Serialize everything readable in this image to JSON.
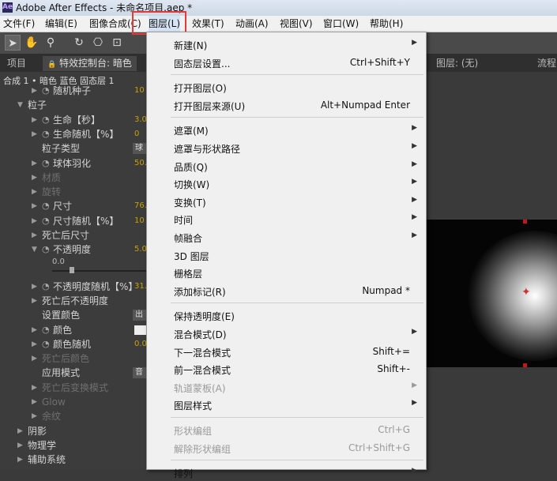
{
  "window": {
    "title": "Adobe After Effects - 未命名项目.aep *"
  },
  "menubar": {
    "items": [
      "文件(F)",
      "编辑(E)",
      "图像合成(C)",
      "图层(L)",
      "效果(T)",
      "动画(A)",
      "视图(V)",
      "窗口(W)",
      "帮助(H)"
    ],
    "active": "图层(L)"
  },
  "panels": {
    "project_tab": "项目",
    "effect_controls_tab": "特效控制台: 暗色",
    "layer_tab": "图层: (无)",
    "flow_tab": "流程",
    "breadcrumb": "合成 1 • 暗色 蓝色 固态层 1"
  },
  "effect_props": [
    {
      "label": "随机种子",
      "value": "10",
      "indent": 2,
      "stopwatch": true
    },
    {
      "label": "粒子",
      "value": "",
      "indent": 1,
      "open": true
    },
    {
      "label": "生命【秒】",
      "value": "3.0",
      "indent": 2,
      "stopwatch": true
    },
    {
      "label": "生命随机【%】",
      "value": "0",
      "indent": 2,
      "stopwatch": true
    },
    {
      "label": "粒子类型",
      "value": "球",
      "indent": 2,
      "dropdown": true
    },
    {
      "label": "球体羽化",
      "value": "50.",
      "indent": 2,
      "stopwatch": true
    },
    {
      "label": "材质",
      "value": "",
      "indent": 2,
      "disabled": true
    },
    {
      "label": "旋转",
      "value": "",
      "indent": 2,
      "disabled": true
    },
    {
      "label": "尺寸",
      "value": "76.",
      "indent": 2,
      "stopwatch": true
    },
    {
      "label": "尺寸随机【%】",
      "value": "10",
      "indent": 2,
      "stopwatch": true
    },
    {
      "label": "死亡后尺寸",
      "value": "",
      "indent": 2
    },
    {
      "label": "不透明度",
      "value": "5.0",
      "indent": 2,
      "stopwatch": true,
      "open": true
    },
    {
      "label": "",
      "value": "0.0",
      "indent": 3,
      "slider": true
    },
    {
      "label": "不透明度随机【%】",
      "value": "31.",
      "indent": 2,
      "stopwatch": true
    },
    {
      "label": "死亡后不透明度",
      "value": "",
      "indent": 2
    },
    {
      "label": "设置颜色",
      "value": "出",
      "indent": 2,
      "dropdown": true
    },
    {
      "label": "颜色",
      "value": "",
      "indent": 2,
      "stopwatch": true,
      "swatch": true
    },
    {
      "label": "颜色随机",
      "value": "0.0",
      "indent": 2,
      "stopwatch": true
    },
    {
      "label": "死亡后颜色",
      "value": "",
      "indent": 2,
      "disabled": true
    },
    {
      "label": "应用模式",
      "value": "音",
      "indent": 2,
      "dropdown": true
    },
    {
      "label": "死亡后变换模式",
      "value": "",
      "indent": 2,
      "disabled": true
    },
    {
      "label": "Glow",
      "value": "",
      "indent": 2,
      "disabled": true
    },
    {
      "label": "余纹",
      "value": "",
      "indent": 2,
      "disabled": true
    },
    {
      "label": "阴影",
      "value": "",
      "indent": 1
    },
    {
      "label": "物理学",
      "value": "",
      "indent": 1
    },
    {
      "label": "辅助系统",
      "value": "",
      "indent": 1
    }
  ],
  "layer_menu": [
    {
      "label": "新建(N)",
      "shortcut": "",
      "submenu": true
    },
    {
      "label": "固态层设置...",
      "shortcut": "Ctrl+Shift+Y"
    },
    {
      "sep": true
    },
    {
      "label": "打开图层(O)",
      "shortcut": ""
    },
    {
      "label": "打开图层来源(U)",
      "shortcut": "Alt+Numpad Enter"
    },
    {
      "sep": true
    },
    {
      "label": "遮罩(M)",
      "shortcut": "",
      "submenu": true
    },
    {
      "label": "遮罩与形状路径",
      "shortcut": "",
      "submenu": true
    },
    {
      "label": "品质(Q)",
      "shortcut": "",
      "submenu": true
    },
    {
      "label": "切换(W)",
      "shortcut": "",
      "submenu": true
    },
    {
      "label": "变换(T)",
      "shortcut": "",
      "submenu": true
    },
    {
      "label": "时间",
      "shortcut": "",
      "submenu": true
    },
    {
      "label": "帧融合",
      "shortcut": "",
      "submenu": true
    },
    {
      "label": "3D 图层",
      "shortcut": ""
    },
    {
      "label": "栅格层",
      "shortcut": ""
    },
    {
      "label": "添加标记(R)",
      "shortcut": "Numpad *"
    },
    {
      "sep": true
    },
    {
      "label": "保持透明度(E)",
      "shortcut": ""
    },
    {
      "label": "混合模式(D)",
      "shortcut": "",
      "submenu": true
    },
    {
      "label": "下一混合模式",
      "shortcut": "Shift+="
    },
    {
      "label": "前一混合模式",
      "shortcut": "Shift+-"
    },
    {
      "label": "轨道蒙板(A)",
      "shortcut": "",
      "submenu": true,
      "disabled": true
    },
    {
      "label": "图层样式",
      "shortcut": "",
      "submenu": true
    },
    {
      "sep": true
    },
    {
      "label": "形状编组",
      "shortcut": "Ctrl+G",
      "disabled": true
    },
    {
      "label": "解除形状编组",
      "shortcut": "Ctrl+Shift+G",
      "disabled": true
    },
    {
      "sep": true
    },
    {
      "label": "排列",
      "shortcut": "",
      "submenu": true
    }
  ],
  "colors": {
    "highlight_box": "#e43a3a",
    "value_text": "#c8a200",
    "menu_bg": "#f0f0f0"
  }
}
